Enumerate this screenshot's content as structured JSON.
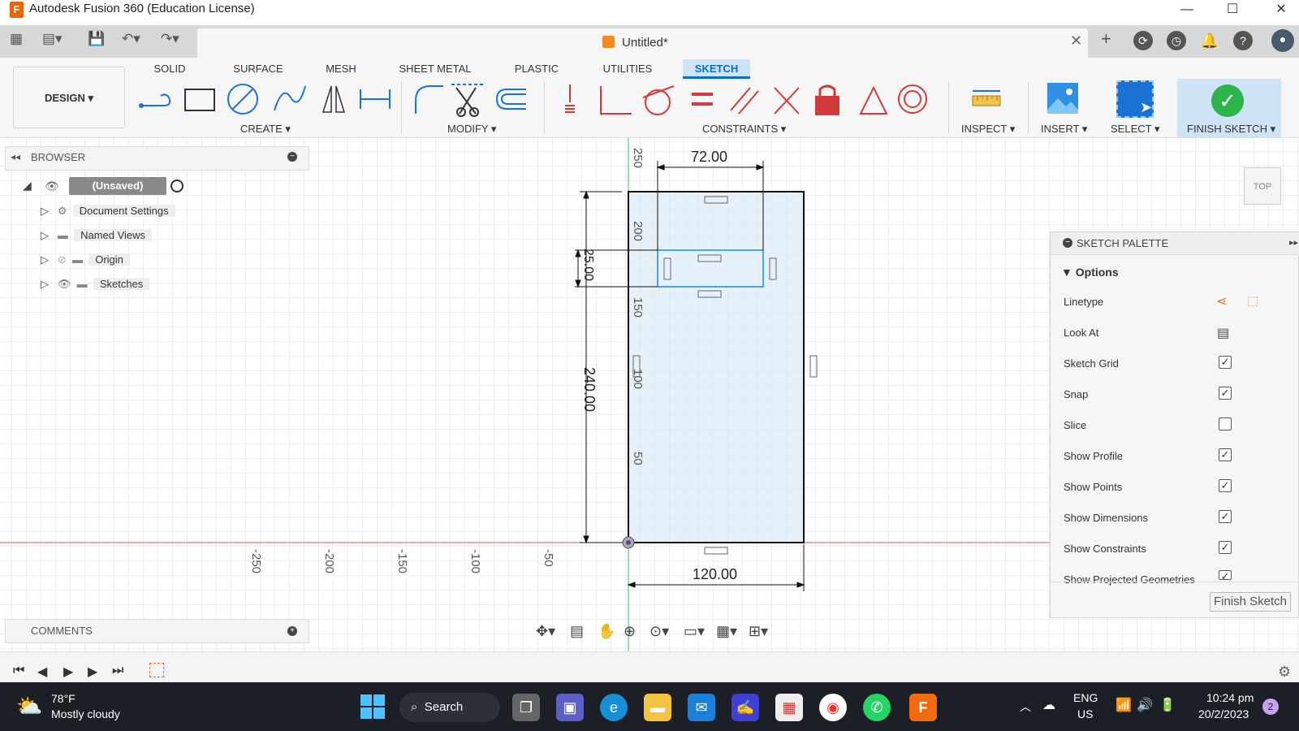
{
  "window": {
    "title": "Autodesk Fusion 360 (Education License)",
    "logo_letter": "F"
  },
  "document": {
    "name": "Untitled*"
  },
  "design_button": "DESIGN ▾",
  "tabs": [
    "SOLID",
    "SURFACE",
    "MESH",
    "SHEET METAL",
    "PLASTIC",
    "UTILITIES",
    "SKETCH"
  ],
  "groups": {
    "create": "CREATE ▾",
    "modify": "MODIFY ▾",
    "constraints": "CONSTRAINTS ▾",
    "inspect": "INSPECT ▾",
    "insert": "INSERT ▾",
    "select": "SELECT ▾",
    "finish": "FINISH SKETCH ▾"
  },
  "browser": {
    "title": "BROWSER",
    "root": "(Unsaved)",
    "items": [
      "Document Settings",
      "Named Views",
      "Origin",
      "Sketches"
    ]
  },
  "comments": {
    "title": "COMMENTS"
  },
  "palette": {
    "title": "SKETCH PALETTE",
    "section": "Options",
    "rows": [
      {
        "label": "Linetype",
        "kind": "icon"
      },
      {
        "label": "Look At",
        "kind": "icon"
      },
      {
        "label": "Sketch Grid",
        "checked": true
      },
      {
        "label": "Snap",
        "checked": true
      },
      {
        "label": "Slice",
        "checked": false
      },
      {
        "label": "Show Profile",
        "checked": true
      },
      {
        "label": "Show Points",
        "checked": true
      },
      {
        "label": "Show Dimensions",
        "checked": true
      },
      {
        "label": "Show Constraints",
        "checked": true
      },
      {
        "label": "Show Projected Geometries",
        "checked": true
      }
    ],
    "finish_button": "Finish Sketch"
  },
  "sketch": {
    "dim_top": "72.00",
    "dim_bottom": "120.00",
    "dim_height": "240.00",
    "dim_small": "25.00",
    "y_ticks": [
      "250",
      "200",
      "150",
      "100",
      "50"
    ],
    "x_ticks": [
      "-250",
      "-200",
      "-150",
      "-100",
      "-50"
    ]
  },
  "view_cube": {
    "face": "TOP"
  },
  "taskbar": {
    "weather_temp": "78°F",
    "weather_desc": "Mostly cloudy",
    "search": "Search",
    "lang1": "ENG",
    "lang2": "US",
    "time": "10:24 pm",
    "date": "20/2/2023",
    "notif_count": "2"
  },
  "colors": {
    "accent": "#0d6ec8",
    "finish_green": "#2cb34a",
    "sketch_fill": "#dbeaf6",
    "axis_red": "#e05050",
    "axis_green": "#3fbf5f"
  }
}
